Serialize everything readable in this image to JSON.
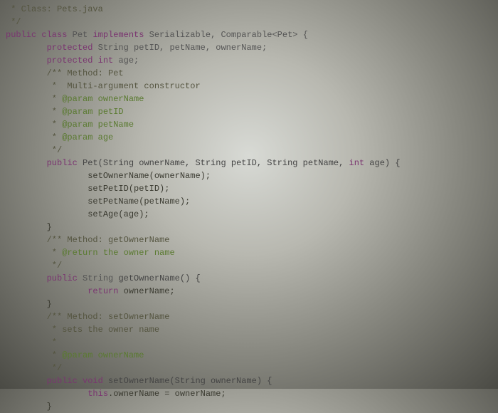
{
  "code": {
    "lines": [
      {
        "indent": 0,
        "segments": [
          {
            "class": "comment",
            "text": " * Class: Pets.java"
          }
        ]
      },
      {
        "indent": 0,
        "segments": [
          {
            "class": "comment",
            "text": " */"
          }
        ]
      },
      {
        "indent": 0,
        "segments": [
          {
            "class": "keyword",
            "text": "public class "
          },
          {
            "class": "type",
            "text": "Pet "
          },
          {
            "class": "keyword",
            "text": "implements "
          },
          {
            "class": "type",
            "text": "Serializable, Comparable<Pet> {"
          }
        ]
      },
      {
        "indent": 8,
        "segments": [
          {
            "class": "keyword",
            "text": "protected "
          },
          {
            "class": "type",
            "text": "String petID, petName, ownerName;"
          }
        ]
      },
      {
        "indent": 8,
        "segments": [
          {
            "class": "keyword",
            "text": "protected int "
          },
          {
            "class": "type",
            "text": "age;"
          }
        ]
      },
      {
        "indent": 0,
        "segments": [
          {
            "class": "",
            "text": ""
          }
        ]
      },
      {
        "indent": 8,
        "segments": [
          {
            "class": "comment",
            "text": "/** Method: Pet"
          }
        ]
      },
      {
        "indent": 8,
        "segments": [
          {
            "class": "comment",
            "text": " *  Multi-argument constructor"
          }
        ]
      },
      {
        "indent": 8,
        "segments": [
          {
            "class": "comment",
            "text": " * "
          },
          {
            "class": "annotation",
            "text": "@param ownerName"
          }
        ]
      },
      {
        "indent": 8,
        "segments": [
          {
            "class": "comment",
            "text": " * "
          },
          {
            "class": "annotation",
            "text": "@param petID"
          }
        ]
      },
      {
        "indent": 8,
        "segments": [
          {
            "class": "comment",
            "text": " * "
          },
          {
            "class": "annotation",
            "text": "@param petName"
          }
        ]
      },
      {
        "indent": 8,
        "segments": [
          {
            "class": "comment",
            "text": " * "
          },
          {
            "class": "annotation",
            "text": "@param age"
          }
        ]
      },
      {
        "indent": 8,
        "segments": [
          {
            "class": "comment",
            "text": " */"
          }
        ]
      },
      {
        "indent": 8,
        "segments": [
          {
            "class": "keyword",
            "text": "public "
          },
          {
            "class": "method",
            "text": "Pet(String ownerName, String petID, String petName, "
          },
          {
            "class": "keyword",
            "text": "int"
          },
          {
            "class": "method",
            "text": " age) {"
          }
        ]
      },
      {
        "indent": 16,
        "segments": [
          {
            "class": "",
            "text": "setOwnerName(ownerName);"
          }
        ]
      },
      {
        "indent": 16,
        "segments": [
          {
            "class": "",
            "text": "setPetID(petID);"
          }
        ]
      },
      {
        "indent": 16,
        "segments": [
          {
            "class": "",
            "text": "setPetName(petName);"
          }
        ]
      },
      {
        "indent": 16,
        "segments": [
          {
            "class": "",
            "text": "setAge(age);"
          }
        ]
      },
      {
        "indent": 8,
        "segments": [
          {
            "class": "",
            "text": "}"
          }
        ]
      },
      {
        "indent": 0,
        "segments": [
          {
            "class": "",
            "text": ""
          }
        ]
      },
      {
        "indent": 8,
        "segments": [
          {
            "class": "comment",
            "text": "/** Method: getOwnerName"
          }
        ]
      },
      {
        "indent": 8,
        "segments": [
          {
            "class": "comment",
            "text": " * "
          },
          {
            "class": "annotation",
            "text": "@return the owner name"
          }
        ]
      },
      {
        "indent": 8,
        "segments": [
          {
            "class": "comment",
            "text": " */"
          }
        ]
      },
      {
        "indent": 8,
        "segments": [
          {
            "class": "keyword",
            "text": "public "
          },
          {
            "class": "type",
            "text": "String "
          },
          {
            "class": "method",
            "text": "getOwnerName() {"
          }
        ]
      },
      {
        "indent": 16,
        "segments": [
          {
            "class": "keyword",
            "text": "return "
          },
          {
            "class": "",
            "text": "ownerName;"
          }
        ]
      },
      {
        "indent": 8,
        "segments": [
          {
            "class": "",
            "text": "}"
          }
        ]
      },
      {
        "indent": 0,
        "segments": [
          {
            "class": "",
            "text": ""
          }
        ]
      },
      {
        "indent": 8,
        "segments": [
          {
            "class": "comment",
            "text": "/** Method: setOwnerName"
          }
        ]
      },
      {
        "indent": 8,
        "segments": [
          {
            "class": "comment",
            "text": " * sets the owner name"
          }
        ]
      },
      {
        "indent": 8,
        "segments": [
          {
            "class": "comment",
            "text": " *"
          }
        ]
      },
      {
        "indent": 8,
        "segments": [
          {
            "class": "comment",
            "text": " * "
          },
          {
            "class": "annotation",
            "text": "@param ownerName"
          }
        ]
      },
      {
        "indent": 8,
        "segments": [
          {
            "class": "comment",
            "text": " */"
          }
        ]
      },
      {
        "indent": 8,
        "segments": [
          {
            "class": "keyword",
            "text": "public void "
          },
          {
            "class": "method",
            "text": "setOwnerName(String ownerName) {"
          }
        ]
      },
      {
        "indent": 16,
        "segments": [
          {
            "class": "keyword",
            "text": "this"
          },
          {
            "class": "",
            "text": ".ownerName = ownerName;"
          }
        ]
      },
      {
        "indent": 8,
        "segments": [
          {
            "class": "",
            "text": "}"
          }
        ]
      }
    ]
  }
}
